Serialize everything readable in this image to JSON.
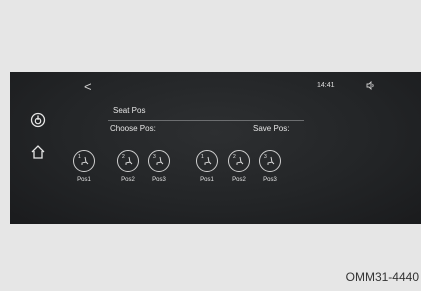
{
  "header": {
    "back_symbol": "<",
    "clock": "14:41",
    "volume_icon": "speaker-icon"
  },
  "side": {
    "power_icon": "power-icon",
    "home_icon": "home-icon"
  },
  "panel": {
    "title": "Seat Pos",
    "choose_label": "Choose Pos:",
    "save_label": "Save Pos:"
  },
  "choose_positions": [
    {
      "num": "1",
      "label": "Pos1"
    },
    {
      "num": "2",
      "label": "Pos2"
    },
    {
      "num": "3",
      "label": "Pos3"
    }
  ],
  "save_positions": [
    {
      "num": "1",
      "label": "Pos1"
    },
    {
      "num": "2",
      "label": "Pos2"
    },
    {
      "num": "3",
      "label": "Pos3"
    }
  ],
  "caption": "OMM31-4440"
}
